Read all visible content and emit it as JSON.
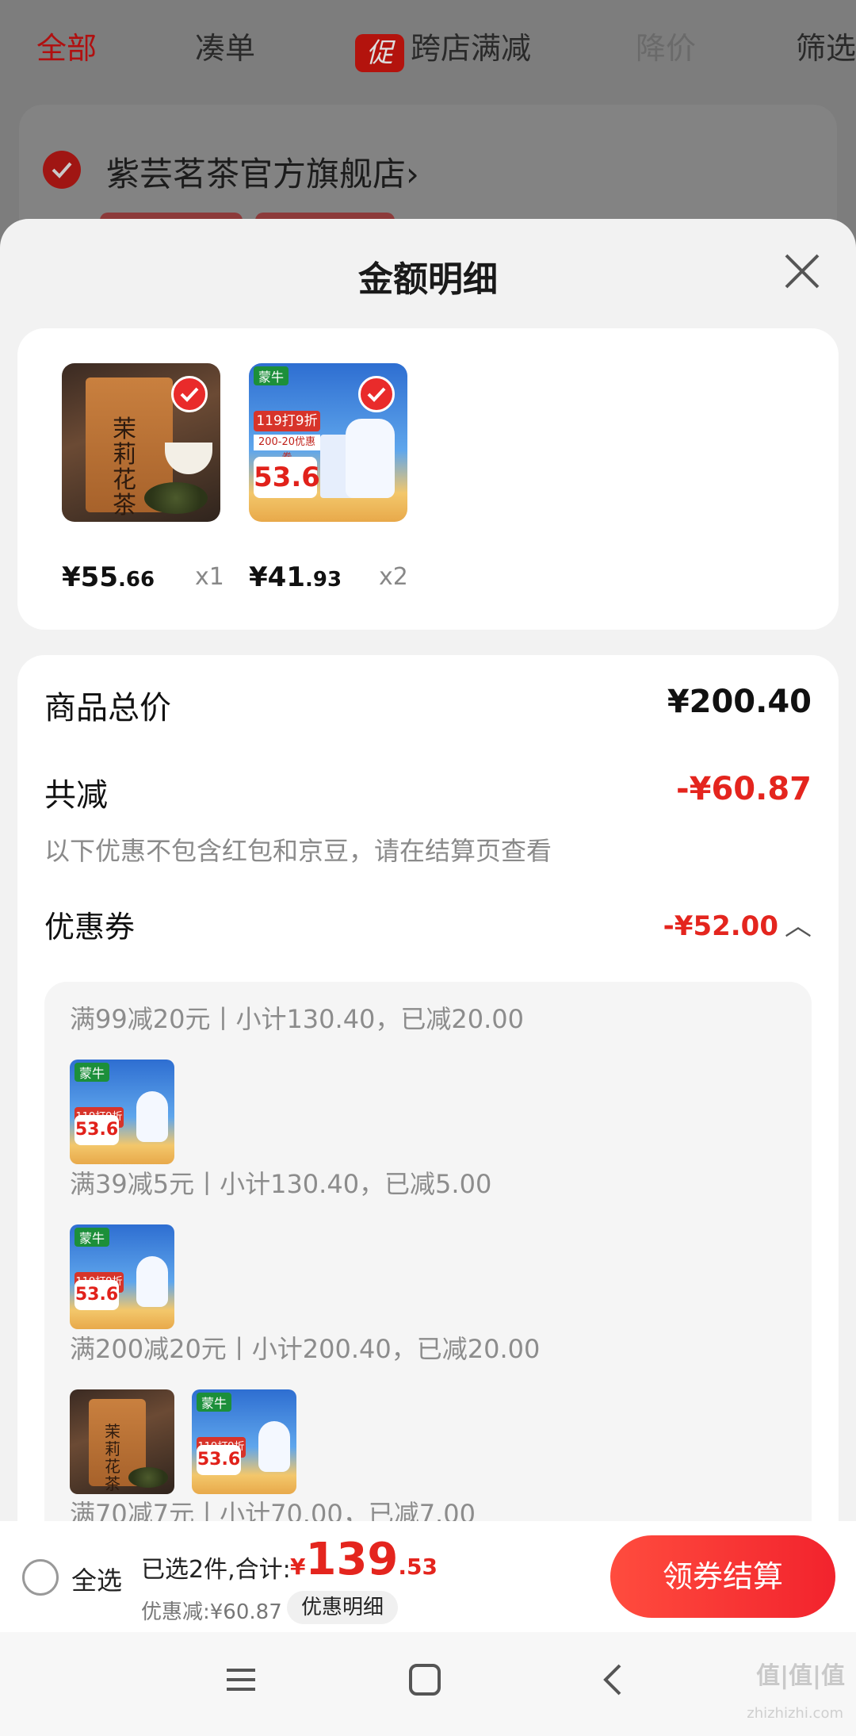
{
  "background": {
    "tabs": [
      {
        "label": "全部"
      },
      {
        "label": "凑单"
      },
      {
        "badge": "促",
        "label": "跨店满减"
      },
      {
        "label": "降价"
      },
      {
        "label": "筛选"
      }
    ],
    "shop_name": "紫芸茗茶官方旗舰店",
    "shop_chevron": "›"
  },
  "sheet": {
    "title": "金额明细",
    "products": [
      {
        "image": "tea-product",
        "price_int": "¥55",
        "price_dec": ".66",
        "qty": "x1"
      },
      {
        "image": "milk-product",
        "price_int": "¥41",
        "price_dec": ".93",
        "qty": "x2"
      }
    ],
    "summary": {
      "total_label": "商品总价",
      "total_value": "¥200.40",
      "reduce_label": "共减",
      "reduce_value": "-¥60.87",
      "hint": "以下优惠不包含红包和京豆，请在结算页查看",
      "coupon_label": "优惠券",
      "coupon_value": "-¥52.00",
      "coupon_chevron": "︿"
    },
    "coupons": [
      {
        "rule": "满99减20元丨小计130.40，已减20.00"
      },
      {
        "rule": "满39减5元丨小计130.40，已减5.00"
      },
      {
        "rule": "满200减20元丨小计200.40，已减20.00"
      },
      {
        "rule": "满70减7元丨小计70.00，已减7.00"
      }
    ]
  },
  "bottom": {
    "select_all": "全选",
    "selected_text": "已选2件,合计:",
    "total_currency": "¥",
    "total_int": "139",
    "total_dec": ".53",
    "discount": "优惠减:¥60.87",
    "detail_button": "优惠明细",
    "checkout_button": "领券结算"
  },
  "watermark": {
    "main": "值|值|值",
    "sub": "zhizhizhi.com"
  },
  "colors": {
    "accent": "#e4251e",
    "sheet_bg": "#f2f2f2"
  }
}
